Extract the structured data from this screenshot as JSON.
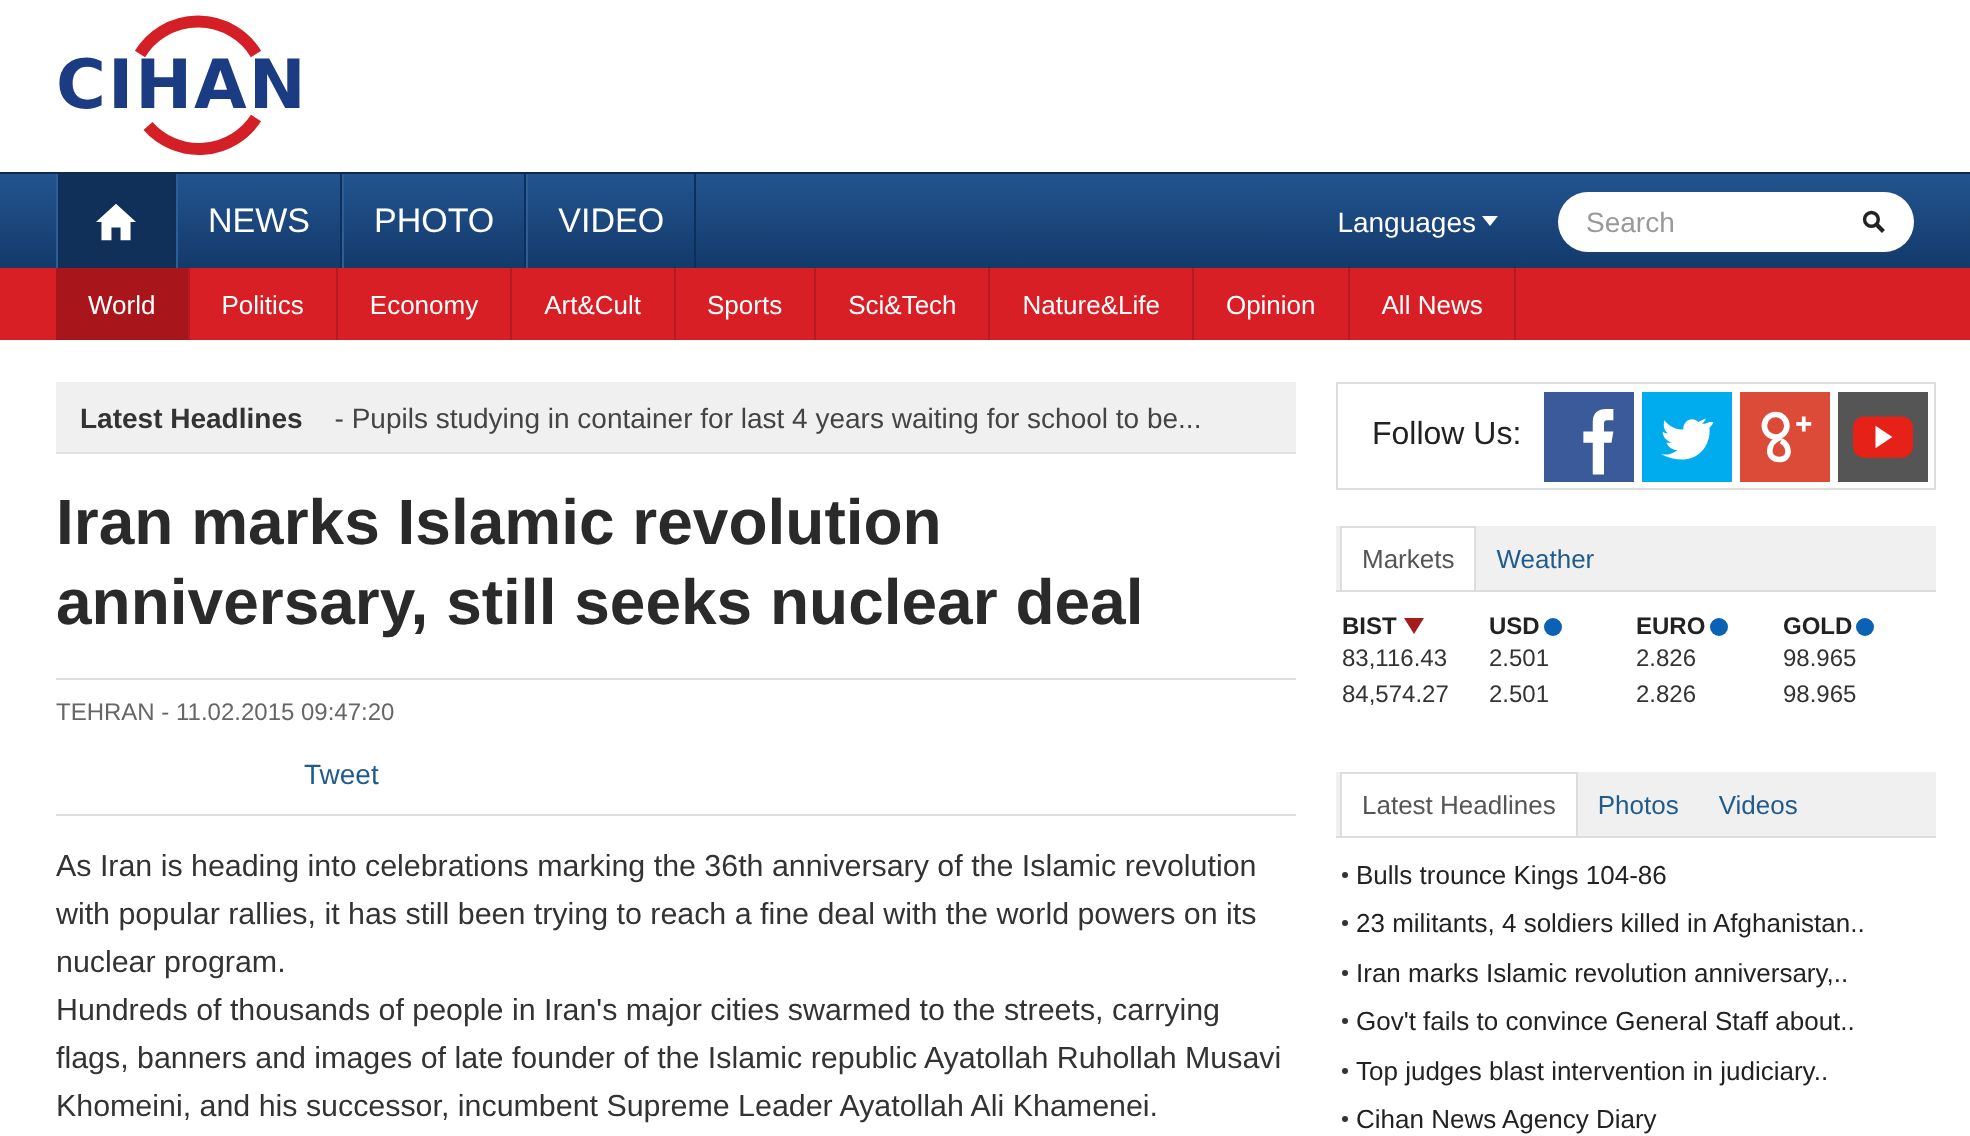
{
  "logo": {
    "text": "CIHAN"
  },
  "main_nav": {
    "items": [
      {
        "kind": "home",
        "selected": true
      },
      {
        "label": "NEWS",
        "selected": false
      },
      {
        "label": "PHOTO",
        "selected": false
      },
      {
        "label": "VIDEO",
        "selected": false
      }
    ],
    "languages": "Languages",
    "search": {
      "placeholder": "Search"
    }
  },
  "categories": [
    {
      "label": "World",
      "selected": true
    },
    {
      "label": "Politics",
      "selected": false
    },
    {
      "label": "Economy",
      "selected": false
    },
    {
      "label": "Art&Cult",
      "selected": false
    },
    {
      "label": "Sports",
      "selected": false
    },
    {
      "label": "Sci&Tech",
      "selected": false
    },
    {
      "label": "Nature&Life",
      "selected": false
    },
    {
      "label": "Opinion",
      "selected": false
    },
    {
      "label": "All News",
      "selected": false
    }
  ],
  "ticker": {
    "label": "Latest Headlines",
    "text": "- Pupils studying in container for last 4 years waiting for school to be..."
  },
  "article": {
    "title": "Iran marks Islamic revolution anniversary, still seeks nuclear deal",
    "dateline": "TEHRAN - 11.02.2015 09:47:20",
    "tweet": "Tweet",
    "paragraphs": [
      "As Iran is heading into celebrations marking the 36th anniversary of the Islamic revolution with popular rallies, it has still been trying to reach a fine deal with the world powers on its nuclear program.",
      "Hundreds of thousands of people in Iran's major cities swarmed to the streets, carrying flags, banners and images of late founder of the Islamic republic Ayatollah Ruhollah Musavi Khomeini, and his successor, incumbent Supreme Leader Ayatollah Ali Khamenei."
    ]
  },
  "follow": {
    "label": "Follow Us:",
    "networks": [
      {
        "kind": "facebook"
      },
      {
        "kind": "twitter"
      },
      {
        "kind": "googleplus"
      },
      {
        "kind": "youtube"
      }
    ]
  },
  "markets": {
    "tabs": [
      {
        "label": "Markets",
        "selected": true
      },
      {
        "label": "Weather",
        "selected": false
      }
    ],
    "columns": [
      {
        "name": "BIST",
        "kind": "down",
        "values": [
          "83,116.43",
          "84,574.27"
        ]
      },
      {
        "name": "USD",
        "kind": "steady",
        "values": [
          "2.501",
          "2.501"
        ]
      },
      {
        "name": "EURO",
        "kind": "steady",
        "values": [
          "2.826",
          "2.826"
        ]
      },
      {
        "name": "GOLD",
        "kind": "steady",
        "values": [
          "98.965",
          "98.965"
        ]
      }
    ]
  },
  "news_box": {
    "tabs": [
      {
        "label": "Latest Headlines",
        "selected": true
      },
      {
        "label": "Photos",
        "selected": false
      },
      {
        "label": "Videos",
        "selected": false
      }
    ],
    "items": [
      "Bulls trounce Kings 104-86",
      "23 militants, 4 soldiers killed in Afghanistan..",
      "Iran marks Islamic revolution anniversary,..",
      "Gov't fails to convince General Staff about..",
      "Top judges blast intervention in judiciary..",
      "Cihan News Agency Diary"
    ]
  }
}
